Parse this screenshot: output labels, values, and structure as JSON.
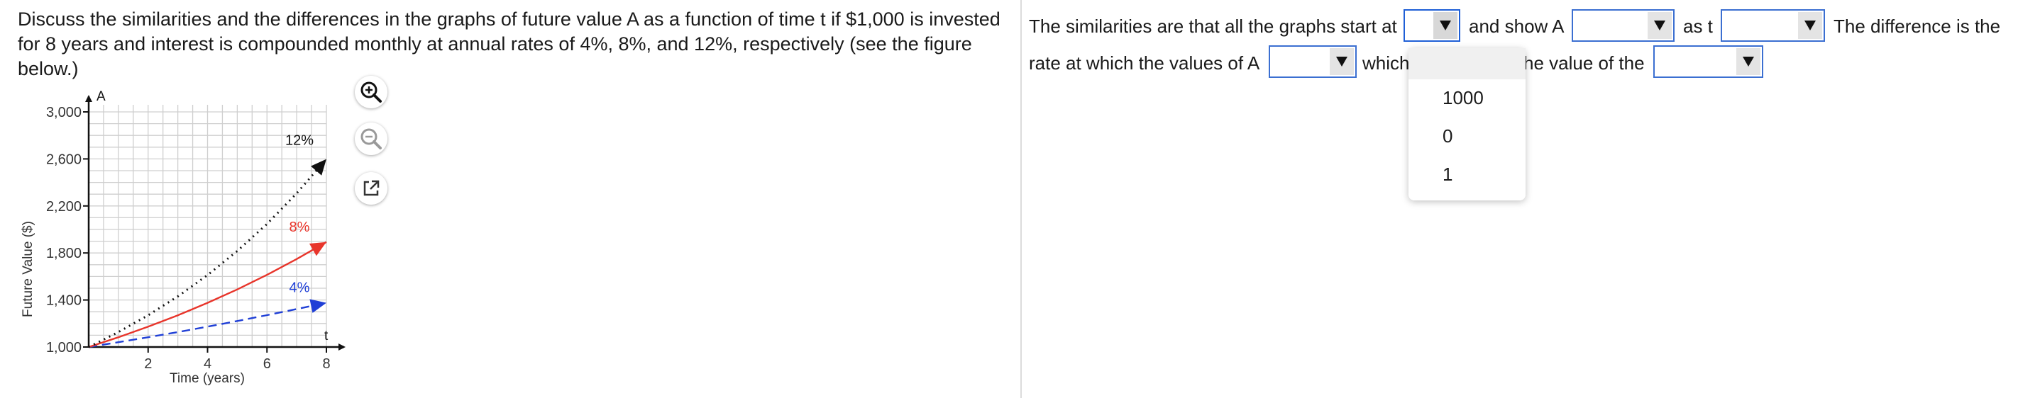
{
  "question": {
    "text": "Discuss the similarities and the differences in the graphs of future value A as a function of time t if $1,000 is invested for 8 years and interest is compounded monthly at annual rates of 4%, 8%, and 12%, respectively (see the figure below.)"
  },
  "chart_data": {
    "type": "line",
    "xlabel": "Time (years)",
    "ylabel": "Future Value ($)",
    "x_axis_name": "t",
    "y_axis_name": "A",
    "xlim": [
      0,
      8
    ],
    "ylim": [
      1000,
      3000
    ],
    "x_ticks": [
      "2",
      "4",
      "6",
      "8"
    ],
    "y_ticks": [
      "1,000",
      "1,400",
      "1,800",
      "2,200",
      "2,600",
      "3,000"
    ],
    "grid": true,
    "series": [
      {
        "name": "4%",
        "color": "#1f3fd6",
        "style": "dashed",
        "x": [
          0,
          1,
          2,
          3,
          4,
          5,
          6,
          7,
          8
        ],
        "values": [
          1000,
          1041,
          1083,
          1127,
          1173,
          1221,
          1271,
          1323,
          1376
        ]
      },
      {
        "name": "8%",
        "color": "#e8352b",
        "style": "solid",
        "x": [
          0,
          1,
          2,
          3,
          4,
          5,
          6,
          7,
          8
        ],
        "values": [
          1000,
          1083,
          1173,
          1270,
          1376,
          1490,
          1614,
          1748,
          1893
        ]
      },
      {
        "name": "12%",
        "color": "#111111",
        "style": "dotted",
        "x": [
          0,
          1,
          2,
          3,
          4,
          5,
          6,
          7,
          8
        ],
        "values": [
          1000,
          1127,
          1270,
          1431,
          1612,
          1817,
          2047,
          2307,
          2599
        ]
      }
    ]
  },
  "tools": {
    "zoom_in": "zoom-in-icon",
    "zoom_out": "zoom-out-icon",
    "pop_out": "external-link-icon"
  },
  "answer": {
    "seg1": "The similarities are that all the graphs start at",
    "seg2": "and show A",
    "seg3": "as t",
    "seg4": "The difference is the",
    "seg5": "rate at which the values of A",
    "seg6": "which",
    "seg7": "he value of the",
    "dropdown_options": [
      "1000",
      "0",
      "1"
    ]
  },
  "colors": {
    "accent": "#3b6fd1",
    "rate_4": "#1f3fd6",
    "rate_8": "#e8352b",
    "rate_12": "#111111"
  }
}
